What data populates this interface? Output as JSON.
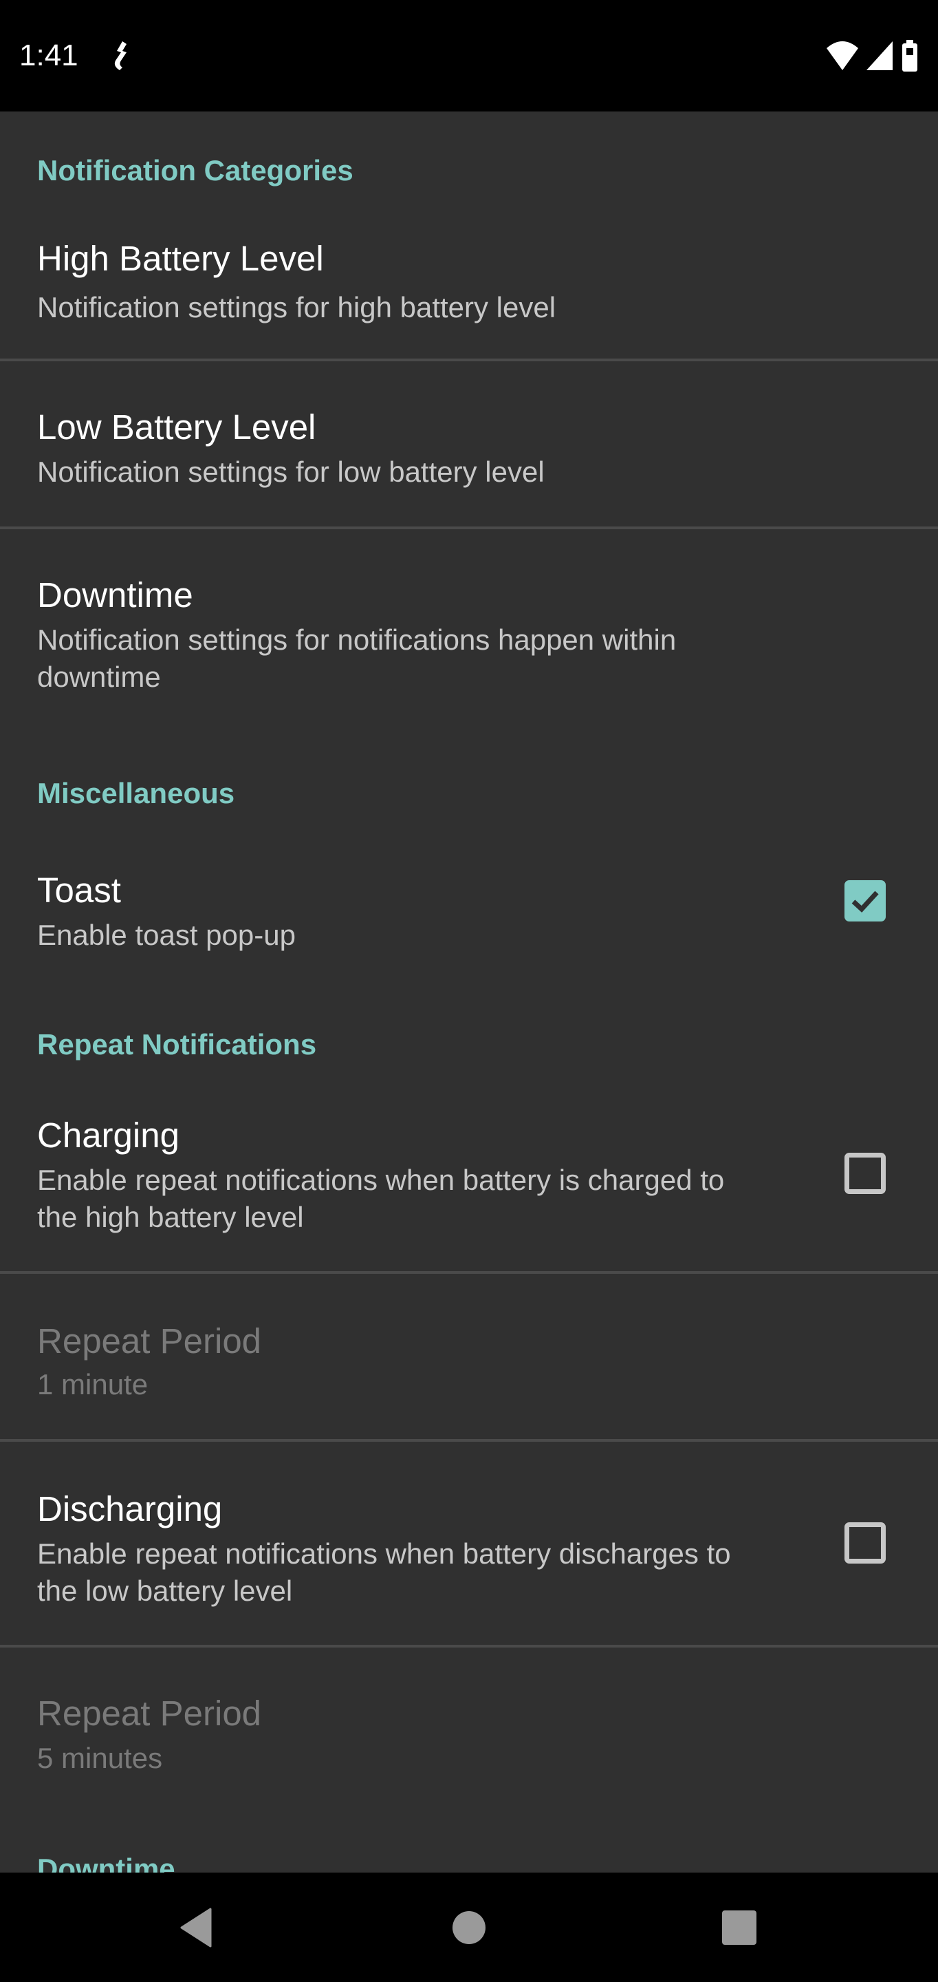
{
  "status_bar": {
    "time": "1:41",
    "icons": [
      "usb-debug-icon",
      "wifi-icon",
      "cell-signal-icon",
      "battery-icon"
    ]
  },
  "sections": {
    "notification_categories": {
      "header": "Notification Categories",
      "items": [
        {
          "title": "High Battery Level",
          "summary": "Notification settings for high battery level"
        },
        {
          "title": "Low Battery Level",
          "summary": "Notification settings for low battery level"
        },
        {
          "title": "Downtime",
          "summary": "Notification settings for notifications happen within downtime"
        }
      ]
    },
    "miscellaneous": {
      "header": "Miscellaneous",
      "items": [
        {
          "title": "Toast",
          "summary": "Enable toast pop-up",
          "checked": true
        }
      ]
    },
    "repeat_notifications": {
      "header": "Repeat Notifications",
      "items": [
        {
          "title": "Charging",
          "summary": "Enable repeat notifications when battery is charged to the high battery level",
          "checked": false
        },
        {
          "title": "Repeat Period",
          "summary": "1 minute",
          "enabled": false
        },
        {
          "title": "Discharging",
          "summary": "Enable repeat notifications when battery discharges to the low battery level",
          "checked": false
        },
        {
          "title": "Repeat Period",
          "summary": "5 minutes",
          "enabled": false
        }
      ]
    },
    "downtime": {
      "header": "Downtime"
    }
  },
  "colors": {
    "accent": "#80cbc4",
    "background": "#303030"
  },
  "nav_bar": {
    "buttons": [
      "back",
      "home",
      "recents"
    ]
  }
}
